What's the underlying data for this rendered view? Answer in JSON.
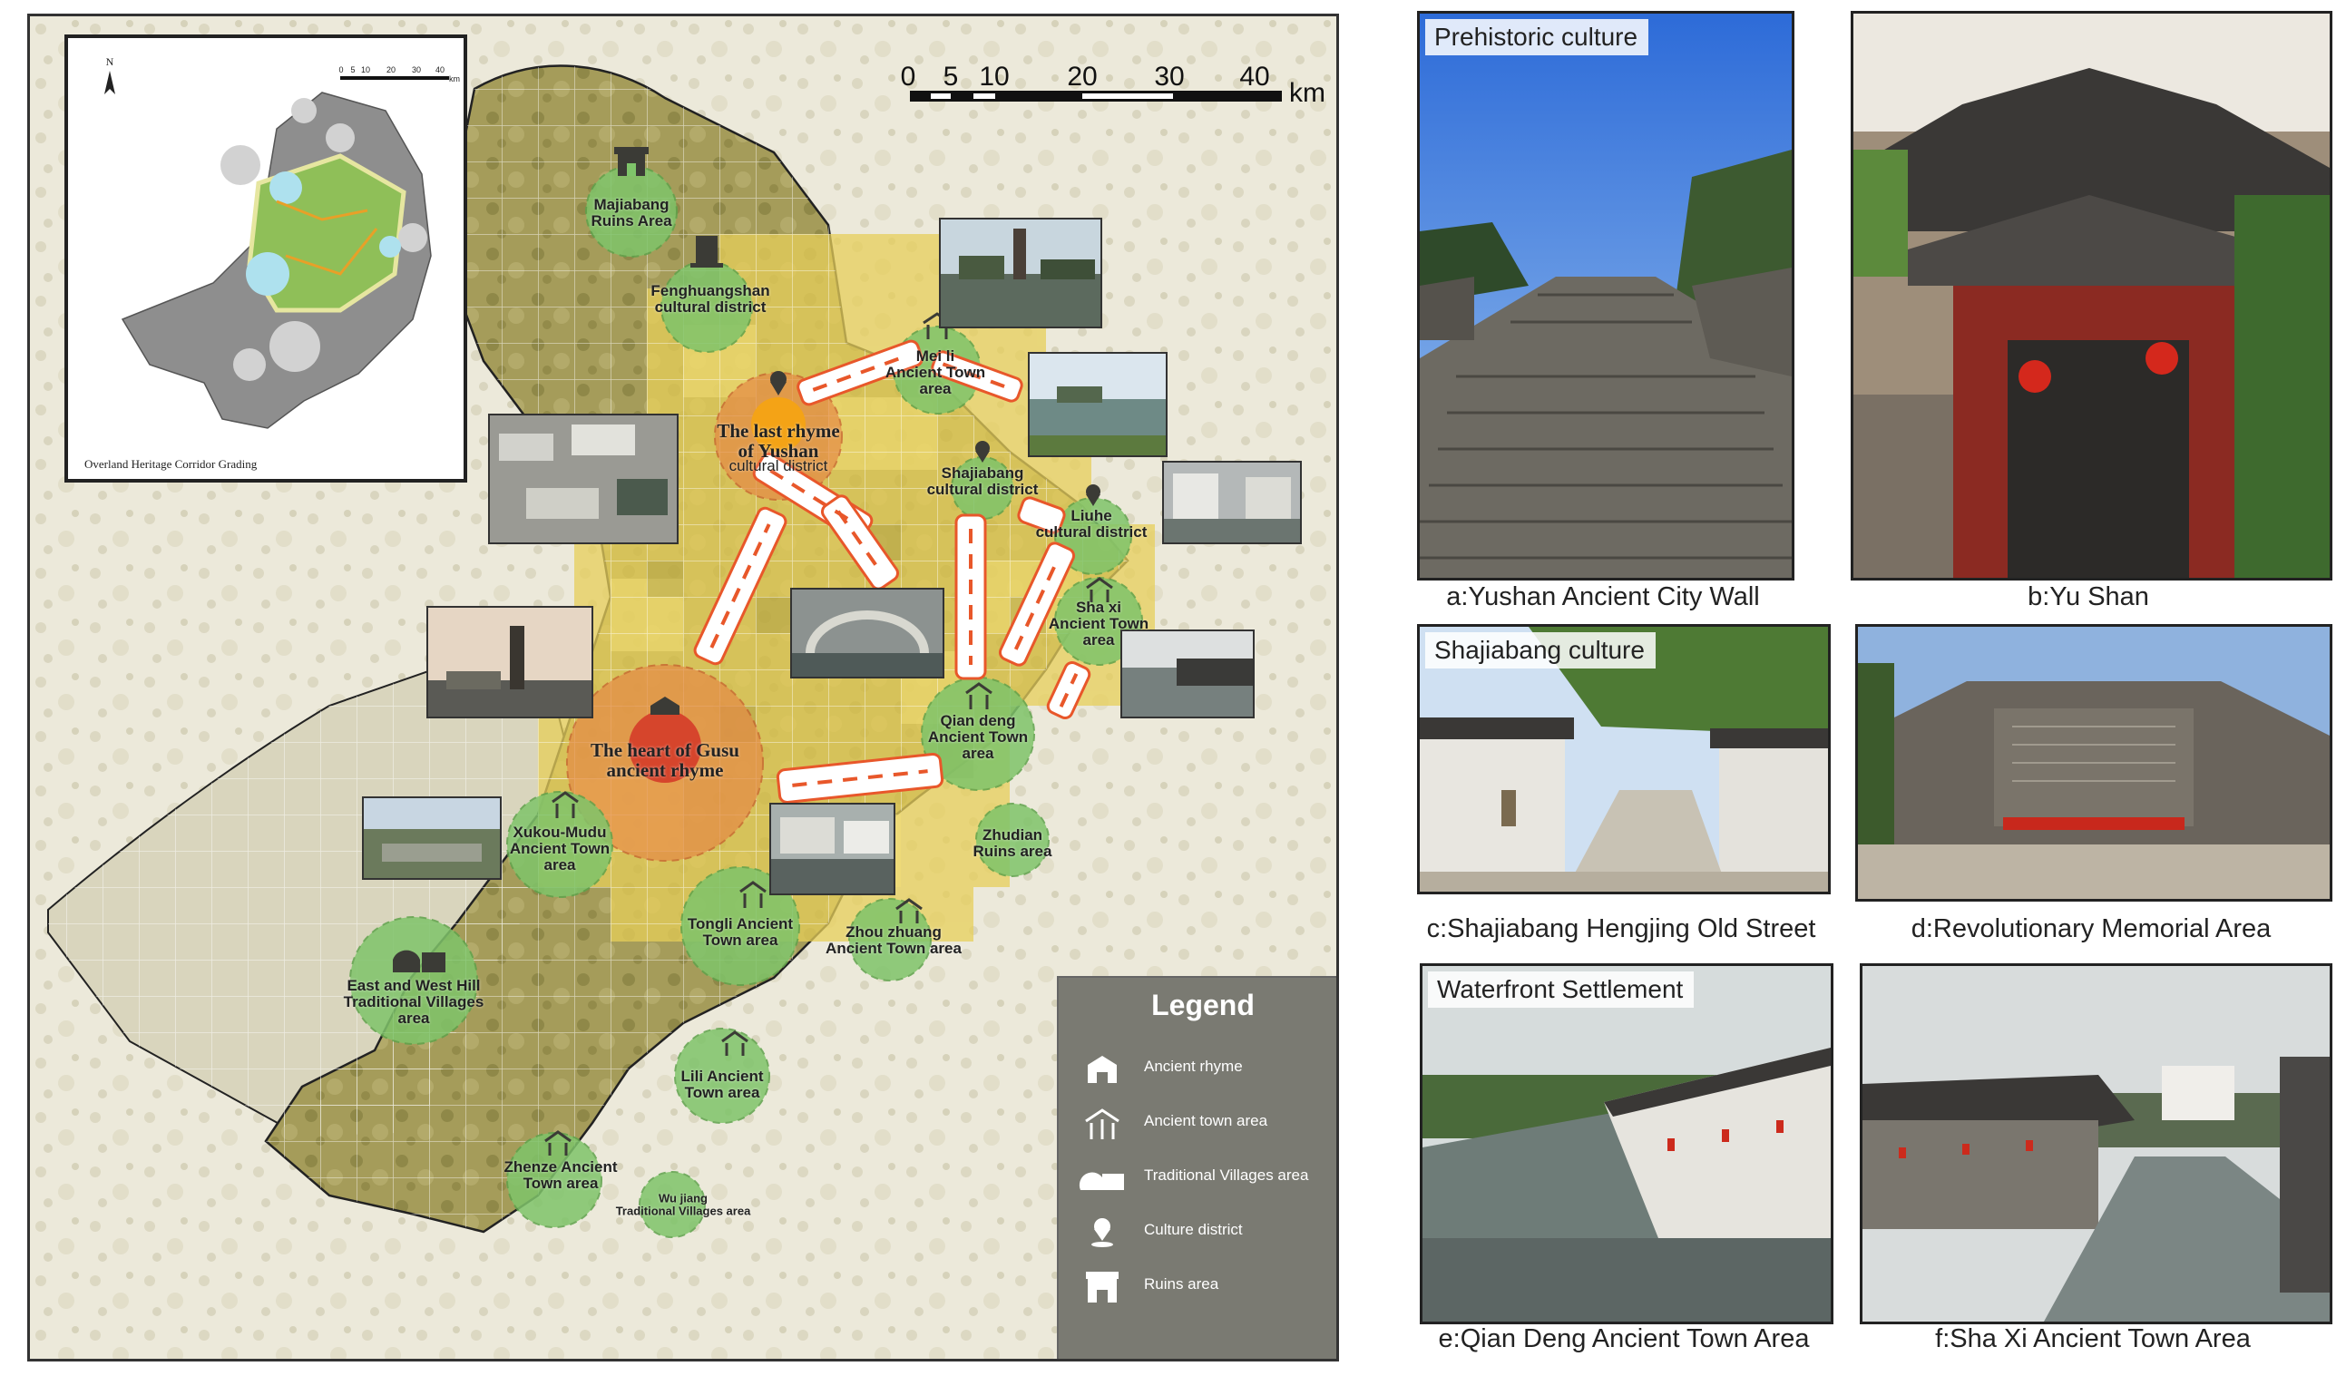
{
  "map": {
    "inset_title": "Overland Heritage Corridor Grading",
    "scale_ticks": [
      "0",
      "5",
      "10",
      "20",
      "30",
      "40"
    ],
    "scale_unit": "km",
    "inset_scale_ticks": [
      "0",
      "5",
      "10",
      "20",
      "30",
      "40"
    ],
    "inset_scale_unit": "km",
    "north_label": "N",
    "labels": {
      "majiabang": "Majiabang\nRuins Area",
      "fenghuangshan": "Fenghuangshan\ncultural district",
      "meili": "Mei li\nAncient Town\narea",
      "yushan": "The last rhyme\nof Yushan",
      "yushan_sub": "cultural district",
      "shajiabang": "Shajiabang\ncultural district",
      "liuhe": "Liuhe\ncultural district",
      "shaxi": "Sha xi\nAncient Town\narea",
      "qiandeng": "Qian deng\nAncient Town\narea",
      "gusu": "The heart of Gusu\nancient rhyme",
      "zhudian": "Zhudian\nRuins area",
      "xukou": "Xukou-Mudu\nAncient Town\narea",
      "tongli": "Tongli Ancient\nTown area",
      "zhouzhuang": "Zhou zhuang\nAncient Town area",
      "eastwest": "East and West Hill\nTraditional Villages\narea",
      "lili": "Lili Ancient\nTown area",
      "zhenze": "Zhenze Ancient\nTown area",
      "wujiang": "Wu jiang\nTraditional Villages area"
    }
  },
  "legend": {
    "title": "Legend",
    "items": [
      {
        "label": "Ancient rhyme",
        "icon": "ancient-rhyme-icon"
      },
      {
        "label": "Ancient town area",
        "icon": "ancient-town-icon"
      },
      {
        "label": "Traditional Villages area",
        "icon": "traditional-village-icon"
      },
      {
        "label": "Culture district",
        "icon": "culture-district-icon"
      },
      {
        "label": "Ruins area",
        "icon": "ruins-area-icon"
      }
    ]
  },
  "photos": {
    "a": {
      "tag": "Prehistoric culture",
      "caption": "a:Yushan Ancient City Wall"
    },
    "b": {
      "caption": "b:Yu Shan"
    },
    "c": {
      "tag": "Shajiabang culture",
      "caption": "c:Shajiabang Hengjing Old Street"
    },
    "d": {
      "caption": "d:Revolutionary Memorial Area"
    },
    "e": {
      "tag": "Waterfront Settlement",
      "caption": "e:Qian Deng Ancient Town Area"
    },
    "f": {
      "caption": "f:Sha Xi Ancient Town Area"
    }
  },
  "colors": {
    "land": "#a79e58",
    "corridor_yellow": "#e7cf5a",
    "node_green": "#7fc46a",
    "core_orange": "#e58a45",
    "core_red": "#d6452c",
    "legend_bg": "#7a7a72"
  }
}
